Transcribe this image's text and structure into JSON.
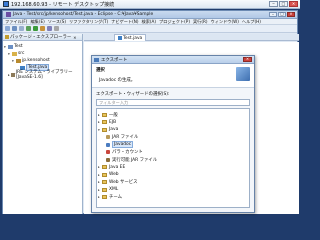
{
  "rdp": {
    "title": "192.168.60.93 - リモート デスクトップ接続"
  },
  "eclipse": {
    "title": "Java - Test/src/jp/kensohost/Test.java - Eclipse - C:¥Java¥Sample",
    "menu": [
      "ファイル(F)",
      "編集(E)",
      "ソース(S)",
      "リファクタリング(T)",
      "ナビゲート(N)",
      "検索(A)",
      "プロジェクト(P)",
      "実行(R)",
      "ウィンドウ(W)",
      "ヘルプ(H)"
    ]
  },
  "explorer": {
    "tab_label": "パッケージ・エクスプローラー",
    "tree": [
      "Test",
      "src",
      "jp.kensohost",
      "Test.java",
      "JRE システム・ライブラリー [JavaSE-1.6]"
    ]
  },
  "editor": {
    "tab_label": "Test.java"
  },
  "dialog": {
    "title": "エクスポート",
    "header_title": "選択",
    "header_desc": "Javadoc の生成。",
    "select_label": "エクスポート・ウィザードの選択(S):",
    "filter_placeholder": "フィルター入力",
    "tree": [
      "一般",
      "EJB",
      "Java",
      "JAR ファイル",
      "Javadoc",
      "パラ・カウント",
      "実行可能 JAR ファイル",
      "Java EE",
      "Web",
      "Web サービス",
      "XML",
      "チーム"
    ]
  },
  "colors": {
    "accent": "#3e7fc5",
    "selection": "#d8e7fa",
    "folder": "#e8c35a"
  }
}
